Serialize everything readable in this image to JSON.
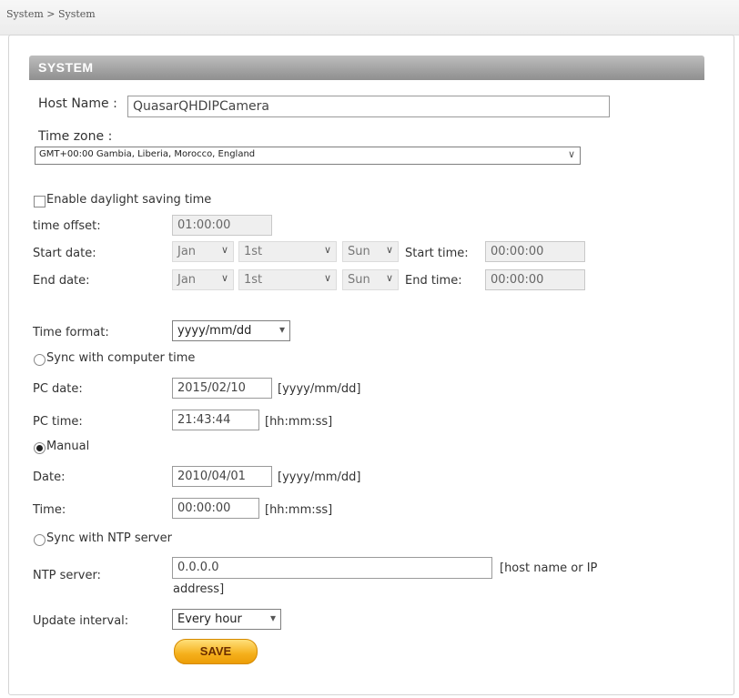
{
  "breadcrumb": "System > System",
  "section_title": "SYSTEM",
  "host_name": {
    "label": "Host Name :",
    "value": "QuasarQHDIPCamera"
  },
  "time_zone": {
    "label": "Time zone :",
    "value": "GMT+00:00 Gambia, Liberia, Morocco, England"
  },
  "dst": {
    "label": "Enable daylight saving time",
    "checked": false,
    "offset_label": "time offset:",
    "offset_value": "01:00:00",
    "start_label": "Start date:",
    "start_month": "Jan",
    "start_day": "1st",
    "start_weekday": "Sun",
    "start_time_label": "Start time:",
    "start_time": "00:00:00",
    "end_label": "End date:",
    "end_month": "Jan",
    "end_day": "1st",
    "end_weekday": "Sun",
    "end_time_label": "End time:",
    "end_time": "00:00:00"
  },
  "time_format": {
    "label": "Time format:",
    "value": "yyyy/mm/dd"
  },
  "sync_computer": {
    "label": "Sync with computer time",
    "selected": false,
    "pc_date_label": "PC date:",
    "pc_date": "2015/02/10",
    "pc_date_hint": "[yyyy/mm/dd]",
    "pc_time_label": "PC time:",
    "pc_time": "21:43:44",
    "pc_time_hint": "[hh:mm:ss]"
  },
  "manual": {
    "label": "Manual",
    "selected": true,
    "date_label": "Date:",
    "date": "2010/04/01",
    "date_hint": "[yyyy/mm/dd]",
    "time_label": "Time:",
    "time": "00:00:00",
    "time_hint": "[hh:mm:ss]"
  },
  "ntp": {
    "label": "Sync with NTP server",
    "selected": false,
    "server_label": "NTP server:",
    "server": "0.0.0.0",
    "server_hint_line1": "[host name or IP",
    "server_hint_line2": "address]",
    "interval_label": "Update interval:",
    "interval": "Every hour"
  },
  "save_label": "SAVE",
  "chevron_glyph": "∨",
  "select_arrow_glyph": "▾",
  "colors": {
    "save_button": "#f5b01c",
    "header_bar": "#9a9a9a"
  }
}
